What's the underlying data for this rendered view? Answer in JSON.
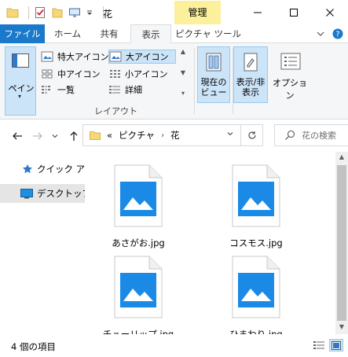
{
  "window": {
    "title": "花",
    "contextual_tab": "管理",
    "controls": {
      "minimize": "—",
      "maximize": "☐",
      "close": "✕"
    }
  },
  "tabs": [
    {
      "label": "ファイル"
    },
    {
      "label": "ホーム"
    },
    {
      "label": "共有"
    },
    {
      "label": "表示"
    },
    {
      "label": "ピクチャ ツール"
    }
  ],
  "tab_right": {
    "collapse": "⌄",
    "help": "?"
  },
  "ribbon": {
    "pane_label": "ペイン",
    "layout_items": [
      "特大アイコン",
      "大アイコン",
      "中アイコン",
      "小アイコン",
      "一覧",
      "詳細"
    ],
    "layout_group_label": "レイアウト",
    "current_view_label": "現在の\nビュー",
    "show_hide_label": "表示/非\n表示",
    "options_label": "オプション"
  },
  "address": {
    "overflow": "«",
    "crumbs": [
      "ピクチャ",
      "花"
    ],
    "separator": "›"
  },
  "search": {
    "placeholder": "花の検索"
  },
  "navpane": {
    "items": [
      {
        "label": "クイック アクセス",
        "icon": "star-icon"
      },
      {
        "label": "デスクトップ",
        "icon": "desktop-icon"
      }
    ]
  },
  "files": [
    {
      "name": "あさがお.jpg"
    },
    {
      "name": "コスモス.jpg"
    },
    {
      "name": "チューリップ.jpg"
    },
    {
      "name": "ひまわり.jpg"
    }
  ],
  "status": {
    "item_count": "4 個の項目"
  },
  "colors": {
    "accent": "#1979ca",
    "contextual": "#fcf09c",
    "selected": "#cce4f7"
  }
}
